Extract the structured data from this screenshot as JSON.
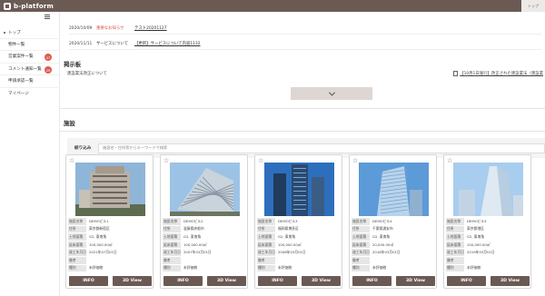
{
  "app": {
    "logo_text": "b-platform",
    "top_right": "トップ"
  },
  "sidebar": {
    "items": [
      {
        "label": "トップ"
      },
      {
        "label": "物件一覧"
      },
      {
        "label": "営業案件一覧",
        "badge": "47"
      },
      {
        "label": "コメント通知一覧",
        "badge": "29"
      },
      {
        "label": "申請承認一覧"
      },
      {
        "label": "マイページ"
      }
    ]
  },
  "news": [
    {
      "date": "2020/10/09",
      "category": "重要なお知らせ",
      "title": "テスト20201127",
      "category_color": "#d9534f"
    },
    {
      "date": "2020/11/11",
      "category": "サービスについて",
      "title": "【更新】サービスについて内容1132",
      "category_color": "#333333"
    }
  ],
  "board": {
    "title": "掲示板",
    "first_line": "建設業法改正について",
    "link": "【10月1日施行】改正された建設業法（建設業"
  },
  "properties": {
    "title": "施設",
    "filter_label": "絞り込み",
    "filter_placeholder": "施設名・住所等からキーワードで検索",
    "field_labels": [
      "施設名称",
      "住所",
      "土地面積",
      "延床面積",
      "竣工年月日",
      "備考",
      "種別"
    ],
    "cards": [
      {
        "name": "DEMOビル1",
        "address": "東京都新宿区",
        "land": "G2, 東南角",
        "floor": "100,000.00㎡",
        "built": "2021年07月01日",
        "note": "",
        "type": "未評価物",
        "photo": "a"
      },
      {
        "name": "DEMOビル2",
        "address": "滋賀県彦根市",
        "land": "G2, 東南角",
        "floor": "100,000.00㎡",
        "built": "2007年03月01日",
        "note": "",
        "type": "未評価物",
        "photo": "b"
      },
      {
        "name": "DEMOビル3",
        "address": "福岡県博多区",
        "land": "G2, 東南角",
        "floor": "100,000.00㎡",
        "built": "2008年03月01日",
        "note": "",
        "type": "未評価物",
        "photo": "c"
      },
      {
        "name": "DEMOビル4",
        "address": "千葉県浦安市",
        "land": "G2, 東南角",
        "floor": "20,000.00㎡",
        "built": "2018年03月01日",
        "note": "",
        "type": "未評価物",
        "photo": "d"
      },
      {
        "name": "DEMOビル5",
        "address": "東京都港区",
        "land": "G2, 東南角",
        "floor": "100,000.00㎡",
        "built": "2019年03月01日",
        "note": "",
        "type": "未評価物",
        "photo": "e"
      }
    ],
    "info_label": "INFO",
    "view_label": "3D View"
  }
}
